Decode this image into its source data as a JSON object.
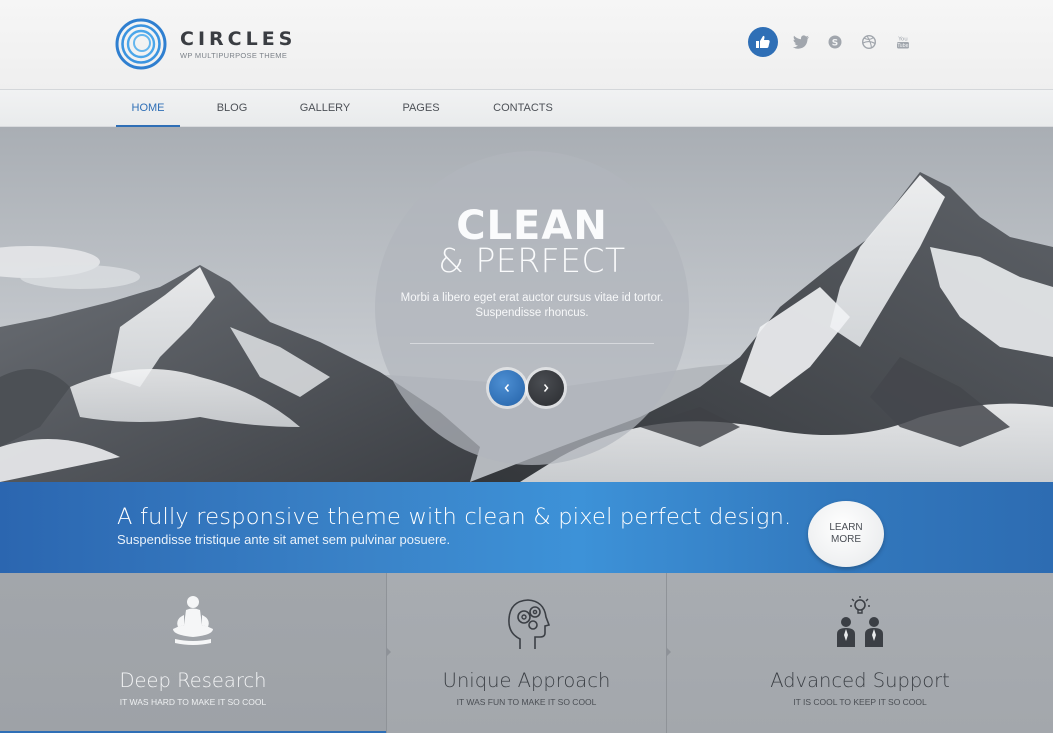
{
  "brand": {
    "name": "CIRCLES",
    "tagline": "WP MULTIPURPOSE THEME",
    "accent": "#2f6fb6"
  },
  "socials": [
    {
      "icon": "thumbs-up-icon"
    },
    {
      "icon": "twitter-icon"
    },
    {
      "icon": "skype-icon"
    },
    {
      "icon": "dribbble-icon"
    },
    {
      "icon": "youtube-icon"
    }
  ],
  "nav": {
    "items": [
      {
        "label": "HOME",
        "active": true
      },
      {
        "label": "BLOG"
      },
      {
        "label": "GALLERY"
      },
      {
        "label": "PAGES"
      },
      {
        "label": "CONTACTS"
      }
    ]
  },
  "hero": {
    "title": "CLEAN",
    "subtitle": "& PERFECT",
    "text": "Morbi a libero eget erat auctor cursus vitae id tortor. Suspendisse rhoncus.",
    "prev_icon": "chevron-left-icon",
    "next_icon": "chevron-right-icon"
  },
  "banner": {
    "title": "A fully responsive theme with clean & pixel perfect design.",
    "subtitle": "Suspendisse tristique ante sit amet sem pulvinar posuere.",
    "cta": "LEARN MORE"
  },
  "features": [
    {
      "icon": "meditation-person-icon",
      "title": "Deep Research",
      "subtitle": "IT WAS HARD TO MAKE IT SO COOL",
      "active": true
    },
    {
      "icon": "head-gears-icon",
      "title": "Unique Approach",
      "subtitle": "IT WAS FUN TO MAKE IT SO COOL"
    },
    {
      "icon": "team-idea-icon",
      "title": "Advanced Support",
      "subtitle": "IT IS COOL TO KEEP IT SO COOL"
    }
  ]
}
